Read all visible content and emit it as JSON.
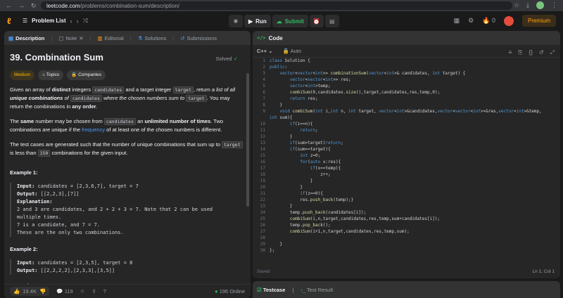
{
  "browser": {
    "url_host": "leetcode.com",
    "url_path": "/problems/combination-sum/description/"
  },
  "header": {
    "problem_list_label": "Problem List",
    "run_label": "Run",
    "submit_label": "Submit",
    "streak_count": "0",
    "premium_label": "Premium"
  },
  "left_tabs": [
    "Description",
    "Note",
    "Editorial",
    "Solutions",
    "Submissions"
  ],
  "problem": {
    "title": "39. Combination Sum",
    "status": "Solved",
    "difficulty": "Medium",
    "tag_topics": "Topics",
    "tag_companies": "Companies",
    "p1_a": "Given an array of ",
    "p1_b": "distinct",
    "p1_c": " integers ",
    "p1_code1": "candidates",
    "p1_d": " and a target integer ",
    "p1_code2": "target",
    "p1_e": ", return ",
    "p1_f": "a list of all ",
    "p1_g": "unique combinations",
    "p1_h": " of ",
    "p1_code3": "candidates",
    "p1_i": " where the chosen numbers sum to ",
    "p1_code4": "target",
    "p1_j": ". You may return the combinations in ",
    "p1_k": "any order",
    "p1_l": ".",
    "p2_a": "The ",
    "p2_b": "same",
    "p2_c": " number may be chosen from ",
    "p2_code": "candidates",
    "p2_d": " an ",
    "p2_e": "unlimited number of times",
    "p2_f": ". Two combinations are unique if the ",
    "p2_link": "frequency",
    "p2_g": " of at least one of the chosen numbers is different.",
    "p3_a": "The test cases are generated such that the number of unique combinations that sum up to ",
    "p3_code1": "target",
    "p3_b": " is less than ",
    "p3_code2": "150",
    "p3_c": " combinations for the given input."
  },
  "examples": [
    {
      "heading": "Example 1:",
      "input_label": "Input:",
      "input": " candidates = [2,3,6,7], target = 7",
      "output_label": "Output:",
      "output": " [[2,2,3],[7]]",
      "explanation_label": "Explanation:",
      "explanation": [
        "2 and 3 are candidates, and 2 + 2 + 3 = 7. Note that 2 can be used",
        "multiple times.",
        "7 is a candidate, and 7 = 7.",
        "These are the only two combinations."
      ]
    },
    {
      "heading": "Example 2:",
      "input_label": "Input:",
      "input": " candidates = [2,3,5], target = 8",
      "output_label": "Output:",
      "output": " [[2,2,2,2],[2,3,3],[3,5]]"
    },
    {
      "heading": "Example 3:"
    }
  ],
  "footer": {
    "likes": "19.4K",
    "comments": "119",
    "online": "196 Online"
  },
  "editor": {
    "title": "Code",
    "language": "C++",
    "mode": "Auto",
    "saved": "Saved",
    "cursor": "Ln 1, Col 1",
    "lines": [
      {
        "n": "1",
        "t": "class Solution {"
      },
      {
        "n": "2",
        "t": "public:"
      },
      {
        "n": "3",
        "t": "    vector<vector<int>> combinationSum(vector<int>& candidates, int target) {"
      },
      {
        "n": "4",
        "t": "        vector<vector<int>> res;"
      },
      {
        "n": "5",
        "t": "        vector<int>temp;"
      },
      {
        "n": "6",
        "t": "        combiSum(0,candidates.size(),target,candidates,res,temp,0);"
      },
      {
        "n": "7",
        "t": "        return res;"
      },
      {
        "n": "8",
        "t": "    }"
      },
      {
        "n": "9",
        "t": "    void combiSum(int i,int n, int target, vector<int>&candidates,vector<vector<int>>&res,vector<int>&temp,"
      },
      {
        "n": "",
        "t": "int sum){"
      },
      {
        "n": "10",
        "t": "        if(i==n){"
      },
      {
        "n": "11",
        "t": "            return;"
      },
      {
        "n": "12",
        "t": "        }"
      },
      {
        "n": "13",
        "t": "        if(sum>target)return;"
      },
      {
        "n": "14",
        "t": "        if(sum==target){"
      },
      {
        "n": "15",
        "t": "            int z=0;"
      },
      {
        "n": "16",
        "t": "            for(auto x:res){"
      },
      {
        "n": "17",
        "t": "                if(x==temp){"
      },
      {
        "n": "18",
        "t": "                    z++;"
      },
      {
        "n": "19",
        "t": "                }"
      },
      {
        "n": "20",
        "t": "            }"
      },
      {
        "n": "21",
        "t": "            if(z==0){"
      },
      {
        "n": "22",
        "t": "            res.push_back(temp);}"
      },
      {
        "n": "23",
        "t": "        }"
      },
      {
        "n": "24",
        "t": "        temp.push_back(candidates[i]);"
      },
      {
        "n": "25",
        "t": "        combiSum(i,n,target,candidates,res,temp,sum+candidates[i]);"
      },
      {
        "n": "26",
        "t": "        temp.pop_back();"
      },
      {
        "n": "27",
        "t": "        combiSum(i+1,n,target,candidates,res,temp,sum);"
      },
      {
        "n": "28",
        "t": ""
      },
      {
        "n": "29",
        "t": "    }"
      },
      {
        "n": "30",
        "t": "};"
      }
    ]
  },
  "testpanel": {
    "testcase": "Testcase",
    "result": "Test Result"
  }
}
